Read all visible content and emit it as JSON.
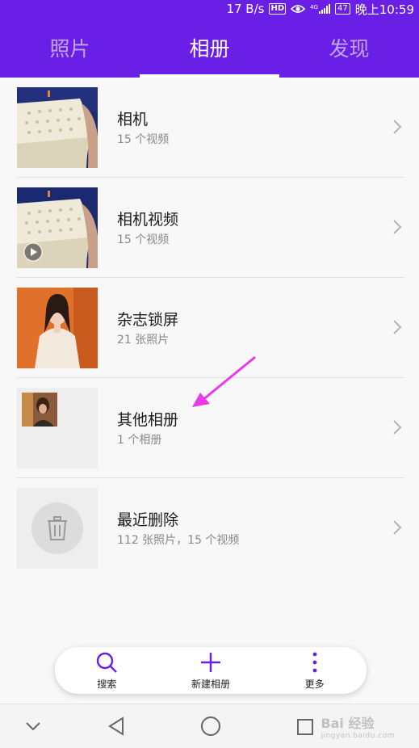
{
  "status_bar": {
    "speed": "17 B/s",
    "hd": "HD",
    "network": "4G",
    "battery": "47",
    "time": "晚上10:59"
  },
  "tabs": [
    {
      "label": "照片",
      "active": false
    },
    {
      "label": "相册",
      "active": true
    },
    {
      "label": "发现",
      "active": false
    }
  ],
  "albums": [
    {
      "title": "相机",
      "subtitle": "15 个视频"
    },
    {
      "title": "相机视频",
      "subtitle": "15 个视频"
    },
    {
      "title": "杂志锁屏",
      "subtitle": "21 张照片"
    },
    {
      "title": "其他相册",
      "subtitle": "1 个相册"
    },
    {
      "title": "最近删除",
      "subtitle": "112 张照片，15 个视频"
    }
  ],
  "bottom_actions": {
    "search": "搜索",
    "new_album": "新建相册",
    "more": "更多"
  },
  "watermark": {
    "text": "Bai 经验",
    "url": "jingyan.baidu.com"
  },
  "colors": {
    "accent": "#6a1fe6",
    "annotation_arrow": "#e73ae8"
  }
}
